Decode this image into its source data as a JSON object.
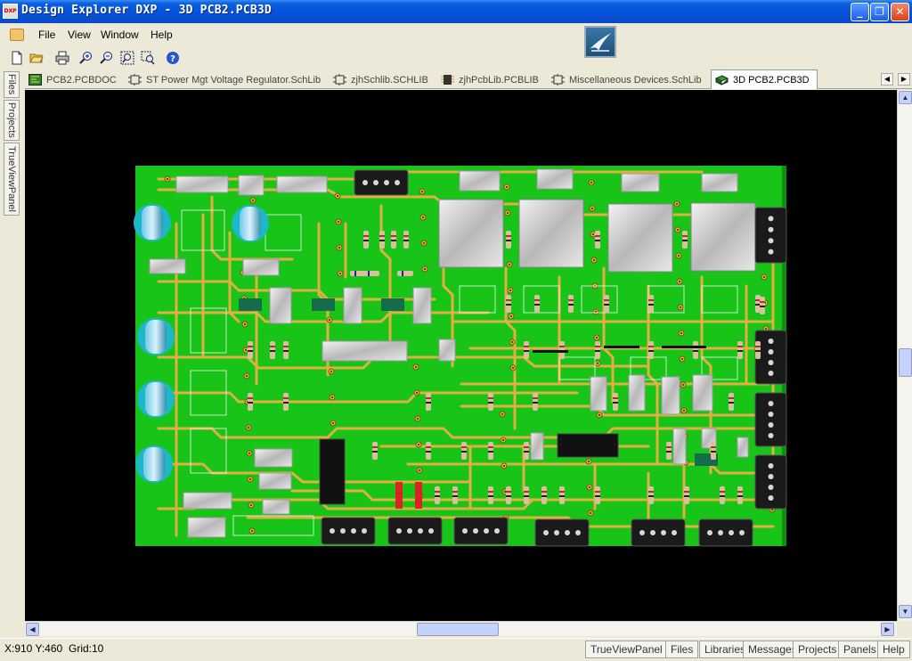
{
  "window": {
    "title": "Design Explorer DXP - 3D PCB2.PCB3D",
    "icon_text": "DXP"
  },
  "menu": {
    "file": "File",
    "view": "View",
    "window": "Window",
    "help": "Help"
  },
  "toolbar": {
    "icons": [
      "new-document-icon",
      "open-folder-icon",
      "print-icon",
      "zoom-in-icon",
      "zoom-out-icon",
      "zoom-fit-icon",
      "zoom-area-icon",
      "help-icon"
    ]
  },
  "tabs": [
    {
      "label": "PCB2.PCBDOC"
    },
    {
      "label": "ST Power Mgt Voltage Regulator.SchLib"
    },
    {
      "label": "zjhSchlib.SCHLIB"
    },
    {
      "label": "zjhPcbLib.PCBLIB"
    },
    {
      "label": "Miscellaneous Devices.SchLib"
    },
    {
      "label": "3D PCB2.PCB3D"
    }
  ],
  "sidepanels": {
    "files": "Files",
    "projects": "Projects",
    "trueview": "TrueViewPanel"
  },
  "status": {
    "coords": "X:910 Y:460",
    "grid": "Grid:10"
  },
  "panel_buttons": [
    "TrueViewPanel",
    "Files",
    "Libraries",
    "Messages",
    "Projects",
    "Panels",
    "Help"
  ],
  "colors": {
    "board": "#19c419",
    "trace": "#e0b040",
    "titlebar": "#0552d8",
    "background": "#000000"
  }
}
